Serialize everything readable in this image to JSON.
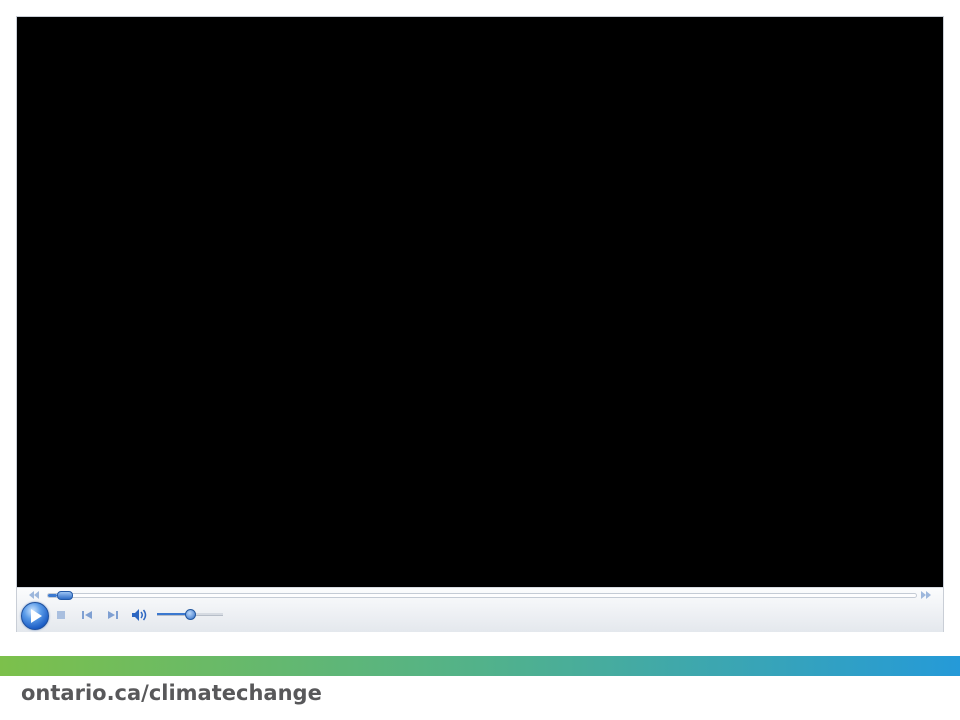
{
  "player": {
    "seek_progress": 0.01,
    "volume_level": 0.5,
    "controls": {
      "seek_back_icon": "rewind-icon",
      "seek_forward_icon": "fast-forward-icon",
      "play_icon": "play-icon",
      "stop_icon": "stop-icon",
      "previous_icon": "previous-track-icon",
      "next_icon": "next-track-icon",
      "mute_icon": "speaker-icon"
    },
    "accent_color": "#3c7ad0"
  },
  "footer": {
    "url": "ontario.ca/climatechange",
    "gradient_colors": [
      "#7cc04b",
      "#52b28a",
      "#259ad8"
    ],
    "text_color": "#58585a"
  }
}
